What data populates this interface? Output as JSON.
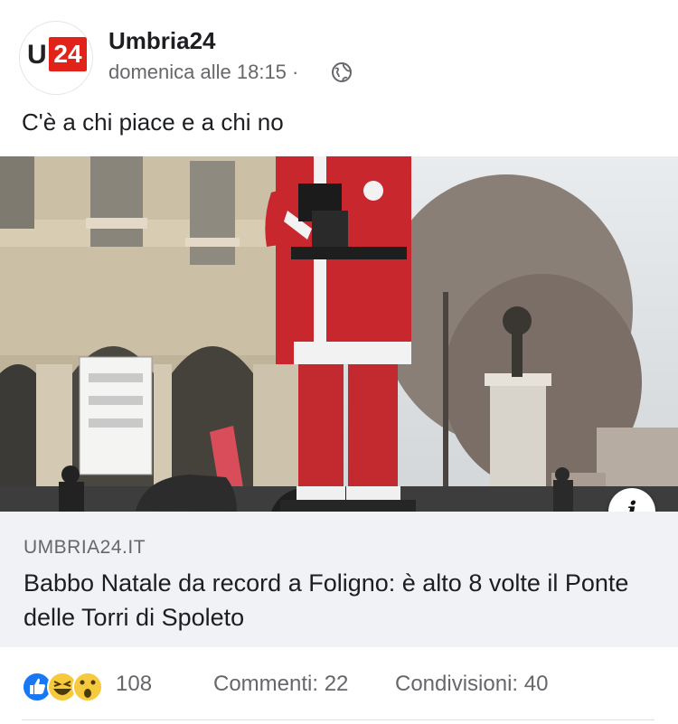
{
  "post": {
    "page_name": "Umbria24",
    "timestamp": "domenica alle 18:15 ·",
    "audience_icon": "globe-icon",
    "text": "C'è a chi piace e a chi no",
    "avatar": {
      "logo_prefix": "U",
      "logo_number": "24",
      "brand_color": "#e2231a"
    }
  },
  "link_preview": {
    "domain": "UMBRIA24.IT",
    "title": "Babbo Natale da record a Foligno: è alto 8 volte il Ponte delle Torri di Spoleto",
    "info_icon": "info-icon"
  },
  "footer": {
    "reactions": [
      "like-icon",
      "laugh-icon",
      "wow-icon"
    ],
    "reaction_count": "108",
    "comments": "Commenti: 22",
    "shares": "Condivisioni: 40"
  }
}
